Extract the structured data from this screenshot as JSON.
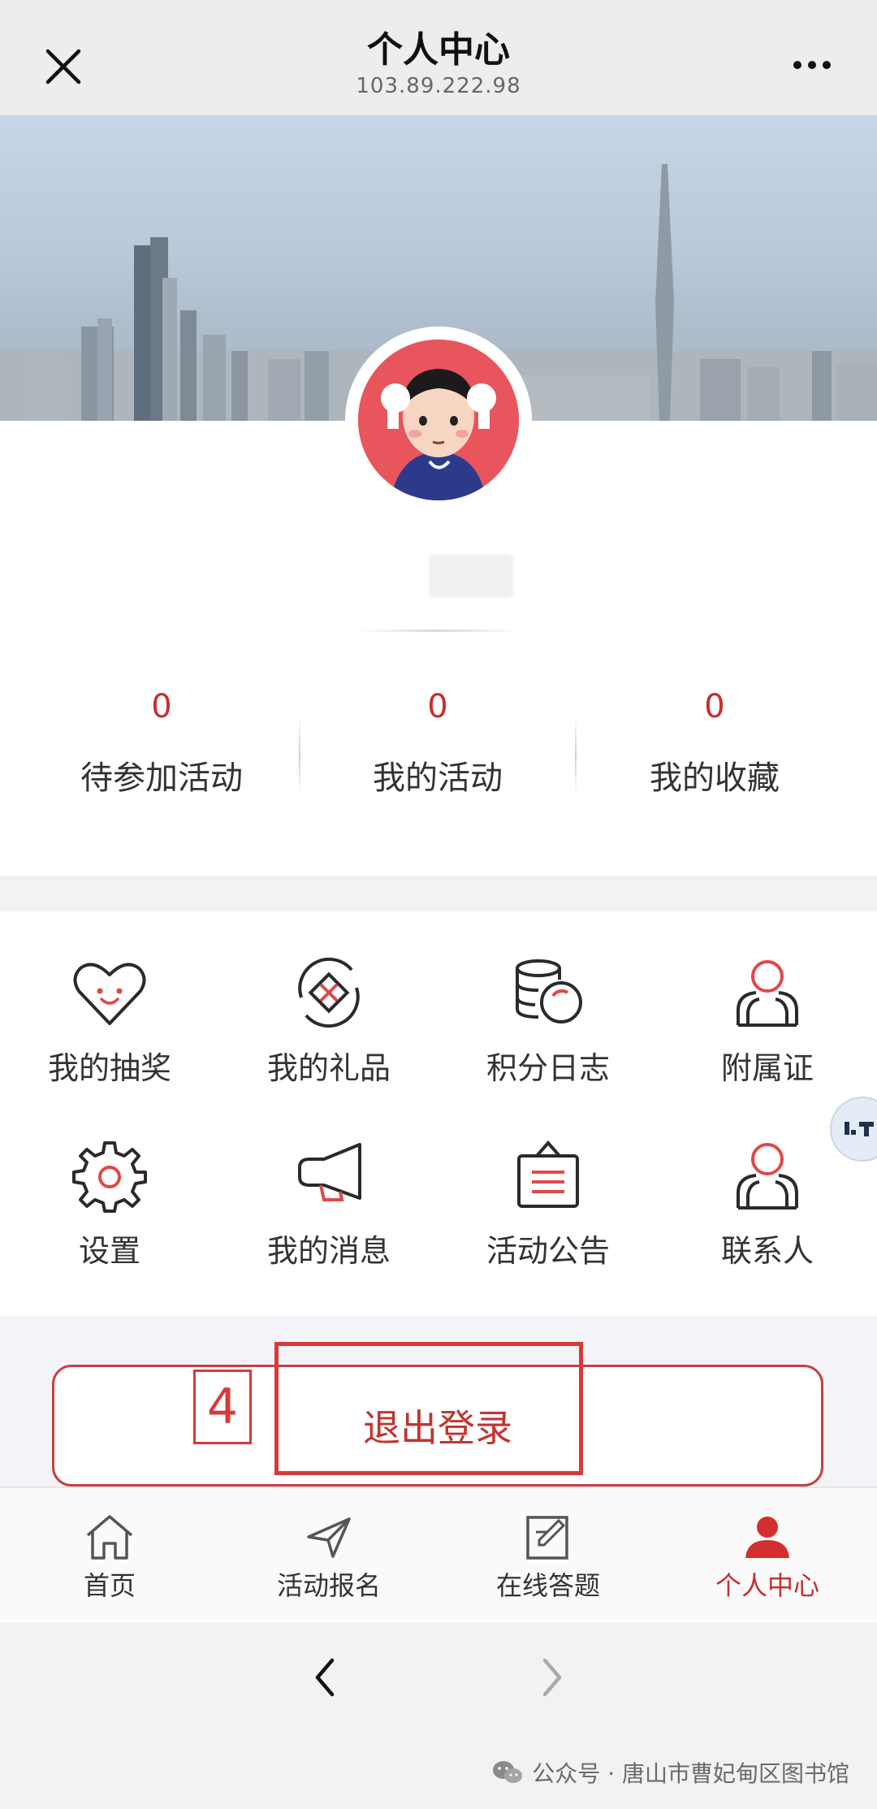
{
  "header": {
    "title": "个人中心",
    "subtitle": "103.89.222.98",
    "close_icon": "close-icon",
    "more_icon": "more-dots-icon"
  },
  "profile": {
    "avatar_icon": "cartoon-avatar"
  },
  "stats": [
    {
      "value": "0",
      "label": "待参加活动"
    },
    {
      "value": "0",
      "label": "我的活动"
    },
    {
      "value": "0",
      "label": "我的收藏"
    }
  ],
  "grid": [
    {
      "label": "我的抽奖",
      "icon": "heart-icon"
    },
    {
      "label": "我的礼品",
      "icon": "gift-icon"
    },
    {
      "label": "积分日志",
      "icon": "coins-icon"
    },
    {
      "label": "附属证",
      "icon": "person-icon"
    },
    {
      "label": "设置",
      "icon": "gear-icon"
    },
    {
      "label": "我的消息",
      "icon": "megaphone-icon"
    },
    {
      "label": "活动公告",
      "icon": "notice-board-icon"
    },
    {
      "label": "联系人",
      "icon": "person-icon"
    }
  ],
  "logout": {
    "label": "退出登录",
    "annotation_number": "4"
  },
  "tabbar": [
    {
      "label": "首页",
      "icon": "home-icon",
      "active": false
    },
    {
      "label": "活动报名",
      "icon": "navigation-arrow-icon",
      "active": false
    },
    {
      "label": "在线答题",
      "icon": "edit-square-icon",
      "active": false
    },
    {
      "label": "个人中心",
      "icon": "user-icon",
      "active": true
    }
  ],
  "watermark": "公众号 · 唐山市曹妃甸区图书馆",
  "colors": {
    "accent": "#c62f2f",
    "avatar_bg": "#e8555c",
    "annotation": "#d63a3a"
  }
}
